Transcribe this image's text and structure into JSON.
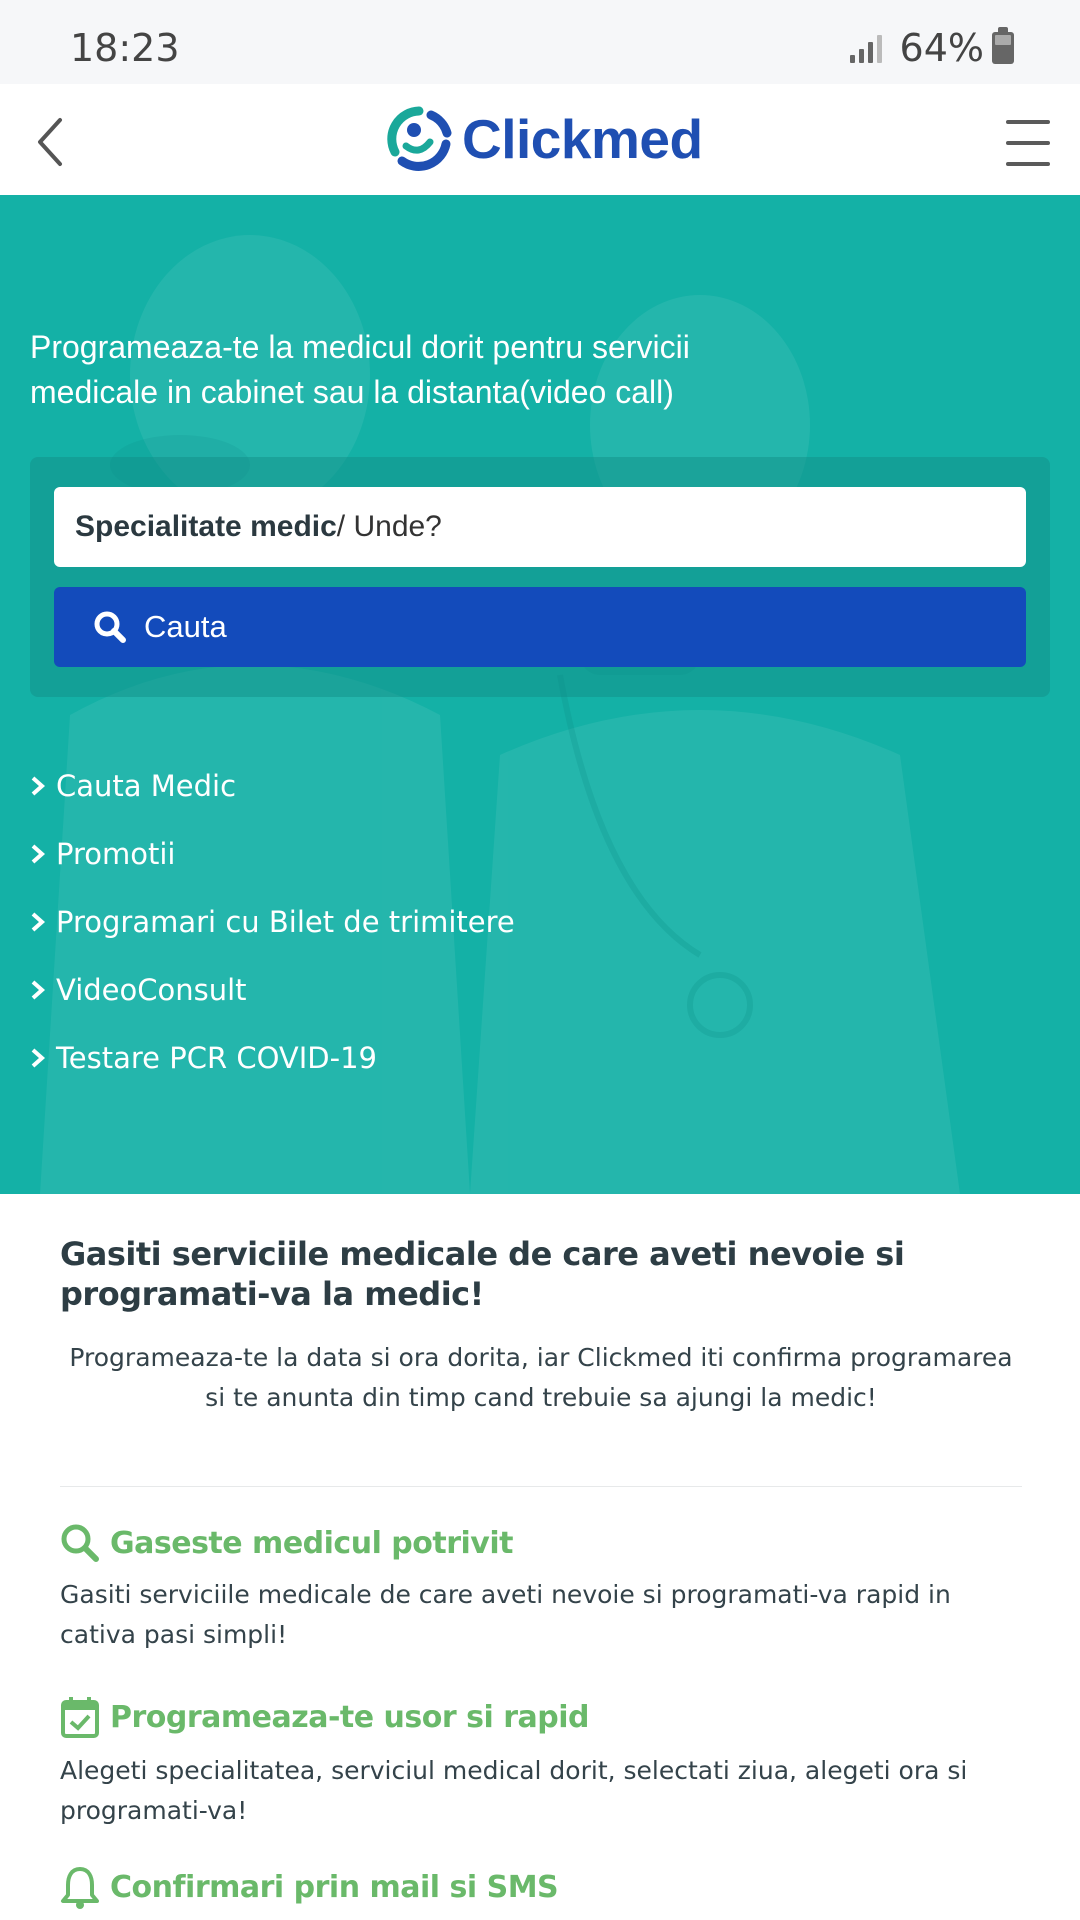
{
  "status_bar": {
    "time": "18:23",
    "battery": "64%"
  },
  "header": {
    "logo_text": "Clickmed"
  },
  "hero": {
    "tagline_line1": "Programeaza-te la medicul dorit pentru servicii",
    "tagline_line2": "medicale in cabinet sau la distanta(video call)",
    "search": {
      "input_label_bold": "Specialitate medic",
      "input_label_rest": " / Unde?",
      "button_label": "Cauta"
    },
    "links": [
      {
        "label": "Cauta Medic"
      },
      {
        "label": "Promotii"
      },
      {
        "label": "Programari cu Bilet de trimitere"
      },
      {
        "label": "VideoConsult"
      },
      {
        "label": "Testare PCR COVID-19"
      }
    ]
  },
  "intro": {
    "title": "Gasiti serviciile medicale de care aveti nevoie si programati-va la medic!",
    "subtitle": "Programeaza-te la data si ora dorita, iar Clickmed iti confirma programarea si te anunta din timp cand trebuie sa ajungi la medic!"
  },
  "features": [
    {
      "icon": "search-icon",
      "title": "Gaseste medicul potrivit",
      "text": "Gasiti serviciile medicale de care aveti nevoie si programati-va rapid in cativa pasi simpli!"
    },
    {
      "icon": "calendar-check-icon",
      "title": "Programeaza-te usor si rapid",
      "text": "Alegeti specialitatea, serviciul medical dorit, selectati ziua, alegeti ora si programati-va!"
    },
    {
      "icon": "bell-icon",
      "title": "Confirmari prin mail si SMS",
      "text": ""
    }
  ],
  "colors": {
    "teal": "#14b1a6",
    "button_blue": "#134bbb",
    "brand_blue": "#1f4fb2",
    "feature_green": "#6ab96a"
  }
}
